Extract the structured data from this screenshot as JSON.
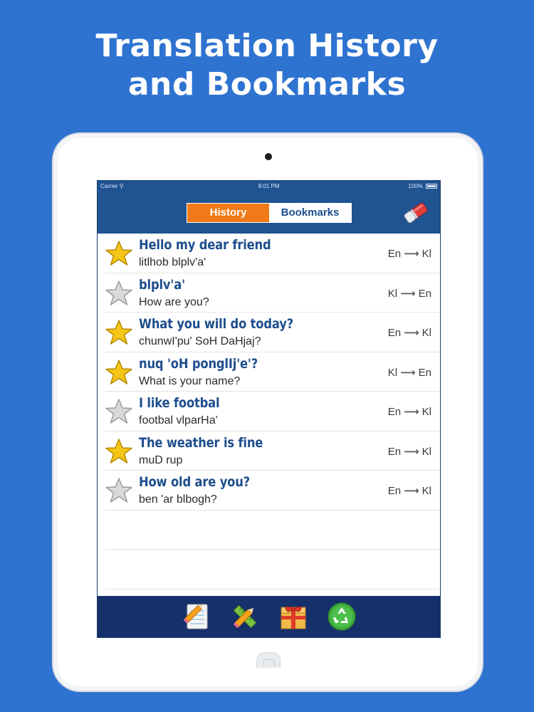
{
  "headline": {
    "line1": "Translation History",
    "line2": "and Bookmarks"
  },
  "status_bar": {
    "carrier": "Carrier",
    "time": "8:01 PM",
    "battery": "100%"
  },
  "tabs": {
    "history_label": "History",
    "bookmarks_label": "Bookmarks",
    "selected": "History"
  },
  "colors": {
    "background": "#2f73d1",
    "navbar": "#1f5392",
    "toolbar": "#15306b",
    "active_tab": "#f07a18",
    "source_text": "#1d4e8c",
    "star_on": "#f5c518",
    "star_off": "#d9d9d9"
  },
  "icons": {
    "clear_history": "eraser-icon",
    "bookmark_on": "star-filled-icon",
    "bookmark_off": "star-empty-icon",
    "toolbar": [
      "notepad-pencil-icon",
      "ruler-pencil-icon",
      "gift-box-icon",
      "recycle-icon"
    ]
  },
  "entries": [
    {
      "source": "Hello my dear friend",
      "translation": "litlhob blplv'a'",
      "from": "En",
      "to": "Kl",
      "bookmarked": true
    },
    {
      "source": "blplv'a'",
      "translation": "How are you?",
      "from": "Kl",
      "to": "En",
      "bookmarked": false
    },
    {
      "source": "What you will do today?",
      "translation": "chunwI'pu' SoH DaHjaj?",
      "from": "En",
      "to": "Kl",
      "bookmarked": true
    },
    {
      "source": "nuq 'oH ponglIj'e'?",
      "translation": "What is your name?",
      "from": "Kl",
      "to": "En",
      "bookmarked": true
    },
    {
      "source": "I like footbal",
      "translation": "footbal vlparHa'",
      "from": "En",
      "to": "Kl",
      "bookmarked": false
    },
    {
      "source": "The weather is fine",
      "translation": " muD rup",
      "from": "En",
      "to": "Kl",
      "bookmarked": true
    },
    {
      "source": "How old are you?",
      "translation": "ben 'ar blbogh?",
      "from": "En",
      "to": "Kl",
      "bookmarked": false
    }
  ]
}
